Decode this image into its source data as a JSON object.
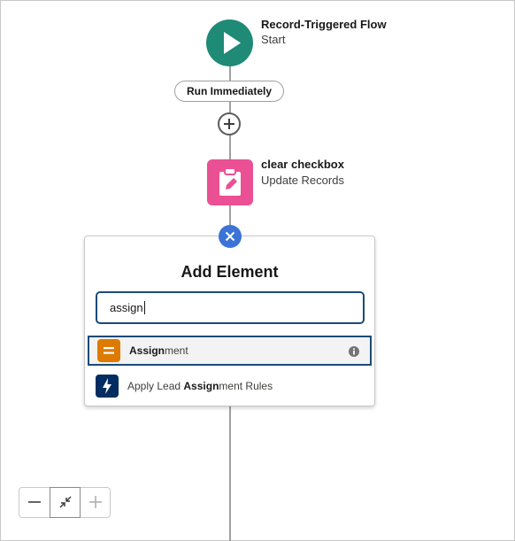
{
  "start": {
    "title": "Record-Triggered Flow",
    "subtitle": "Start",
    "icon": "play-icon",
    "color": "#1f8a76"
  },
  "run_pill": {
    "label": "Run Immediately"
  },
  "add_button": {
    "icon": "plus-icon"
  },
  "update_node": {
    "title": "clear checkbox",
    "subtitle": "Update Records",
    "icon": "clipboard-edit-icon",
    "color": "#ea5093"
  },
  "close_button": {
    "icon": "close-icon",
    "color": "#3b73d6"
  },
  "add_element": {
    "title": "Add Element",
    "search": {
      "value": "assign"
    },
    "results": [
      {
        "prefix": "",
        "match": "Assign",
        "suffix": "ment",
        "icon": "assignment-icon",
        "icon_color": "#dd7a01",
        "selected": true,
        "info_icon": "info-icon"
      },
      {
        "prefix": "Apply Lead ",
        "match": "Assign",
        "suffix": "ment Rules",
        "icon": "lightning-icon",
        "icon_color": "#032d60",
        "selected": false
      }
    ]
  },
  "zoom_controls": {
    "zoom_out_icon": "minus-icon",
    "fit_icon": "collapse-arrows-icon",
    "zoom_in_icon": "plus-icon"
  }
}
